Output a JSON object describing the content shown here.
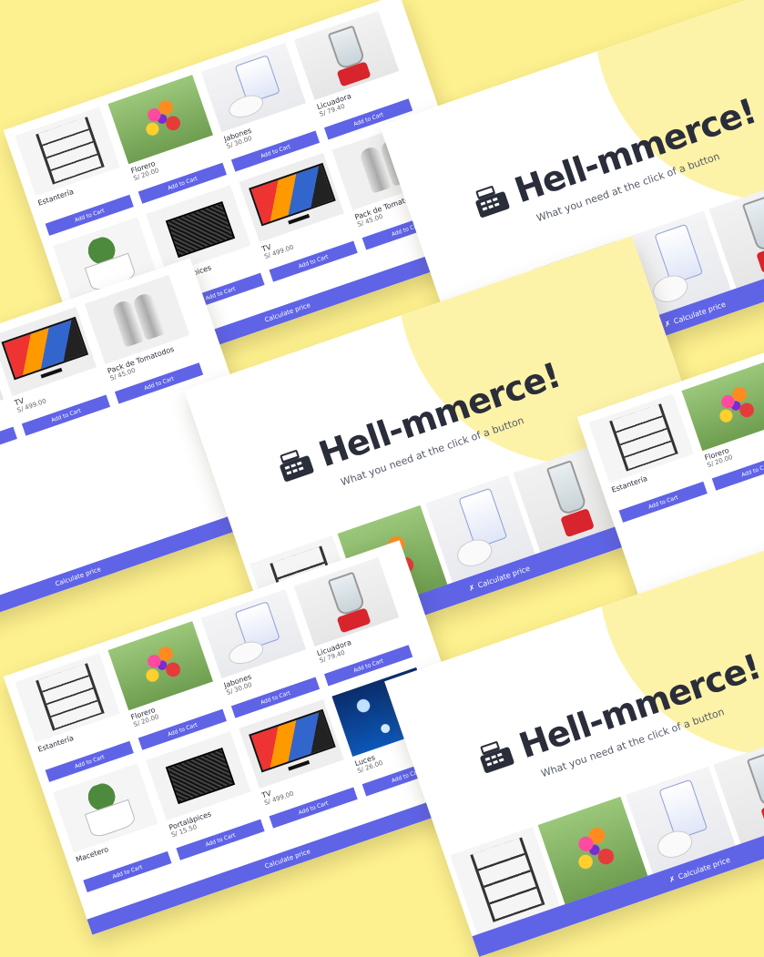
{
  "hero": {
    "logo_icon": "cash-register-icon",
    "title": "Hell-mmerce!",
    "subtitle": "What you need at the click of a button",
    "button_icon": "calculator-icon",
    "button_label": "Calculate price"
  },
  "catalog": {
    "add_to_cart": "Add to Cart",
    "calculate_label": "Calculate price",
    "products": [
      {
        "name": "Estantería",
        "price": "",
        "art": "shelf"
      },
      {
        "name": "Florero",
        "price": "S/ 20.00",
        "art": "flowers"
      },
      {
        "name": "Jabones",
        "price": "S/ 30.00",
        "art": "soap"
      },
      {
        "name": "Licuadora",
        "price": "S/ 79.40",
        "art": "blender"
      },
      {
        "name": "Luces",
        "price": "S/ 26.00",
        "art": "lights"
      },
      {
        "name": "Macetero",
        "price": "",
        "art": "plant"
      },
      {
        "name": "Portalápices",
        "price": "S/ 15.50",
        "art": "organizer"
      },
      {
        "name": "TV",
        "price": "S/ 499.00",
        "art": "tv"
      },
      {
        "name": "Pack de Tomatodos",
        "price": "S/ 45.00",
        "art": "bottles"
      }
    ]
  },
  "colors": {
    "background": "#fdf08e",
    "accent": "#5f63e6",
    "text": "#2a2d3a"
  }
}
